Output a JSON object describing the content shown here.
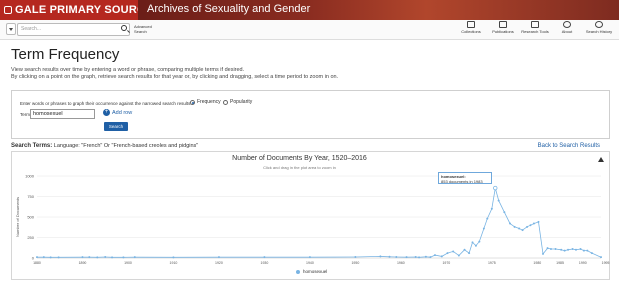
{
  "header": {
    "brand": "GALE PRIMARY SOURCES",
    "title": "Archives of Sexuality and Gender"
  },
  "toolbar": {
    "search_placeholder": "Search...",
    "advanced_label": "Advanced Search",
    "tools": [
      {
        "label": "Collections",
        "icon": "collections-icon"
      },
      {
        "label": "Publications",
        "icon": "publications-icon"
      },
      {
        "label": "Research Tools",
        "icon": "research-tools-icon"
      },
      {
        "label": "About",
        "icon": "help-icon"
      },
      {
        "label": "Search History",
        "icon": "history-icon"
      }
    ]
  },
  "page": {
    "title": "Term Frequency",
    "desc1": "View search results over time by entering a word or phrase, comparing multiple terms if desired.",
    "desc2": "By clicking on a point on the graph, retrieve search results for that year or, by clicking and dragging, select a time period to zoom in on."
  },
  "form": {
    "instructions": "Enter words or phrases to graph their occurrence against the narrowed search results.",
    "radio_frequency": "Frequency",
    "radio_popularity": "Popularity",
    "term_label": "Term",
    "term_value": "homosexuel",
    "add_row": "Add row",
    "search_button": "Search"
  },
  "search_terms": {
    "label": "Search Terms:",
    "value": "Language: \"French\" Or \"French-based creoles and pidgins\"",
    "back_link": "Back to Search Results"
  },
  "chart_data": {
    "type": "line",
    "title": "Number of Documents By Year, 1520–2016",
    "subtitle": "Click and drag in the plot area to zoom in",
    "ylabel": "Number of Documents",
    "xlabel": "",
    "xlim": [
      1520,
      2016
    ],
    "ylim": [
      0,
      1000
    ],
    "y_ticks": [
      0,
      250,
      500,
      750,
      1000
    ],
    "y_tick_labels": [
      "0",
      "250",
      "500",
      "750",
      "1000"
    ],
    "x_ticks": [
      1520,
      1560,
      1600,
      1640,
      1680,
      1720,
      1760,
      1800,
      1840,
      1880,
      1920,
      1960,
      1980,
      2000,
      2020,
      2040,
      2060,
      2080,
      2100
    ],
    "x_tick_labels": [
      "1880",
      "1890",
      "1900",
      "1910",
      "1920",
      "1930",
      "1940",
      "1950",
      "1960",
      "1970",
      "1975",
      "1980",
      "1985",
      "1990",
      "1995",
      "2000",
      "2005",
      "2010"
    ],
    "series": [
      {
        "name": "homosexuel",
        "color": "#79b4e3",
        "x": [
          1520,
          1526,
          1532,
          1539,
          1560,
          1566,
          1573,
          1580,
          1586,
          1596,
          1606,
          1640,
          1680,
          1720,
          1760,
          1800,
          1822,
          1830,
          1836,
          1845,
          1853,
          1856,
          1862,
          1866,
          1870,
          1876,
          1881,
          1886,
          1891,
          1896,
          1900,
          1903,
          1906,
          1909,
          1913,
          1916,
          1920,
          1923,
          1926,
          1931,
          1936,
          1940,
          1944,
          1947,
          1951,
          1954,
          1957,
          1961,
          1965,
          1969,
          1972,
          1976,
          1981,
          1984,
          1987,
          1991,
          1994,
          1998,
          2001,
          2004,
          2008,
          2016
        ],
        "y": [
          10,
          10,
          8,
          8,
          10,
          10,
          8,
          12,
          8,
          8,
          10,
          8,
          10,
          10,
          10,
          12,
          20,
          15,
          12,
          10,
          12,
          8,
          15,
          10,
          35,
          20,
          60,
          80,
          30,
          100,
          60,
          190,
          150,
          200,
          360,
          480,
          600,
          853,
          700,
          560,
          420,
          380,
          360,
          340,
          380,
          400,
          420,
          440,
          50,
          120,
          110,
          110,
          100,
          90,
          100,
          110,
          100,
          110,
          90,
          90,
          60,
          10
        ]
      }
    ],
    "tooltip": {
      "term": "homosexuel:",
      "text": "853 documents in 1983"
    },
    "legend": "bottom"
  }
}
